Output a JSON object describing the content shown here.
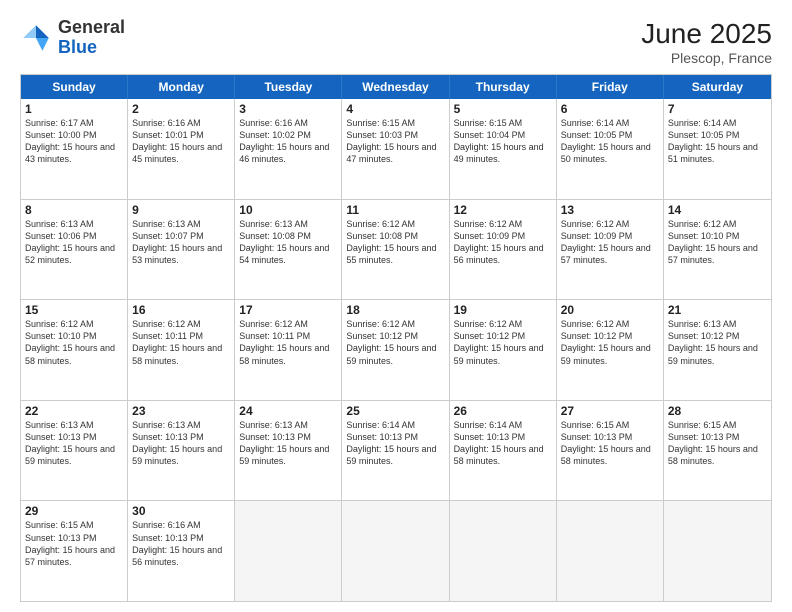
{
  "logo": {
    "general": "General",
    "blue": "Blue"
  },
  "title": {
    "month_year": "June 2025",
    "location": "Plescop, France"
  },
  "weekdays": [
    "Sunday",
    "Monday",
    "Tuesday",
    "Wednesday",
    "Thursday",
    "Friday",
    "Saturday"
  ],
  "rows": [
    [
      {
        "day": "",
        "empty": true
      },
      {
        "day": "2",
        "sr": "Sunrise: 6:16 AM",
        "ss": "Sunset: 10:01 PM",
        "dl": "Daylight: 15 hours and 45 minutes."
      },
      {
        "day": "3",
        "sr": "Sunrise: 6:16 AM",
        "ss": "Sunset: 10:02 PM",
        "dl": "Daylight: 15 hours and 46 minutes."
      },
      {
        "day": "4",
        "sr": "Sunrise: 6:15 AM",
        "ss": "Sunset: 10:03 PM",
        "dl": "Daylight: 15 hours and 47 minutes."
      },
      {
        "day": "5",
        "sr": "Sunrise: 6:15 AM",
        "ss": "Sunset: 10:04 PM",
        "dl": "Daylight: 15 hours and 49 minutes."
      },
      {
        "day": "6",
        "sr": "Sunrise: 6:14 AM",
        "ss": "Sunset: 10:05 PM",
        "dl": "Daylight: 15 hours and 50 minutes."
      },
      {
        "day": "7",
        "sr": "Sunrise: 6:14 AM",
        "ss": "Sunset: 10:05 PM",
        "dl": "Daylight: 15 hours and 51 minutes."
      }
    ],
    [
      {
        "day": "1",
        "sr": "Sunrise: 6:17 AM",
        "ss": "Sunset: 10:00 PM",
        "dl": "Daylight: 15 hours and 43 minutes."
      },
      {
        "day": "",
        "empty": true
      },
      {
        "day": "",
        "empty": true
      },
      {
        "day": "",
        "empty": true
      },
      {
        "day": "",
        "empty": true
      },
      {
        "day": "",
        "empty": true
      },
      {
        "day": "",
        "empty": true
      }
    ],
    [
      {
        "day": "8",
        "sr": "Sunrise: 6:13 AM",
        "ss": "Sunset: 10:06 PM",
        "dl": "Daylight: 15 hours and 52 minutes."
      },
      {
        "day": "9",
        "sr": "Sunrise: 6:13 AM",
        "ss": "Sunset: 10:07 PM",
        "dl": "Daylight: 15 hours and 53 minutes."
      },
      {
        "day": "10",
        "sr": "Sunrise: 6:13 AM",
        "ss": "Sunset: 10:08 PM",
        "dl": "Daylight: 15 hours and 54 minutes."
      },
      {
        "day": "11",
        "sr": "Sunrise: 6:12 AM",
        "ss": "Sunset: 10:08 PM",
        "dl": "Daylight: 15 hours and 55 minutes."
      },
      {
        "day": "12",
        "sr": "Sunrise: 6:12 AM",
        "ss": "Sunset: 10:09 PM",
        "dl": "Daylight: 15 hours and 56 minutes."
      },
      {
        "day": "13",
        "sr": "Sunrise: 6:12 AM",
        "ss": "Sunset: 10:09 PM",
        "dl": "Daylight: 15 hours and 57 minutes."
      },
      {
        "day": "14",
        "sr": "Sunrise: 6:12 AM",
        "ss": "Sunset: 10:10 PM",
        "dl": "Daylight: 15 hours and 57 minutes."
      }
    ],
    [
      {
        "day": "15",
        "sr": "Sunrise: 6:12 AM",
        "ss": "Sunset: 10:10 PM",
        "dl": "Daylight: 15 hours and 58 minutes."
      },
      {
        "day": "16",
        "sr": "Sunrise: 6:12 AM",
        "ss": "Sunset: 10:11 PM",
        "dl": "Daylight: 15 hours and 58 minutes."
      },
      {
        "day": "17",
        "sr": "Sunrise: 6:12 AM",
        "ss": "Sunset: 10:11 PM",
        "dl": "Daylight: 15 hours and 58 minutes."
      },
      {
        "day": "18",
        "sr": "Sunrise: 6:12 AM",
        "ss": "Sunset: 10:12 PM",
        "dl": "Daylight: 15 hours and 59 minutes."
      },
      {
        "day": "19",
        "sr": "Sunrise: 6:12 AM",
        "ss": "Sunset: 10:12 PM",
        "dl": "Daylight: 15 hours and 59 minutes."
      },
      {
        "day": "20",
        "sr": "Sunrise: 6:12 AM",
        "ss": "Sunset: 10:12 PM",
        "dl": "Daylight: 15 hours and 59 minutes."
      },
      {
        "day": "21",
        "sr": "Sunrise: 6:13 AM",
        "ss": "Sunset: 10:12 PM",
        "dl": "Daylight: 15 hours and 59 minutes."
      }
    ],
    [
      {
        "day": "22",
        "sr": "Sunrise: 6:13 AM",
        "ss": "Sunset: 10:13 PM",
        "dl": "Daylight: 15 hours and 59 minutes."
      },
      {
        "day": "23",
        "sr": "Sunrise: 6:13 AM",
        "ss": "Sunset: 10:13 PM",
        "dl": "Daylight: 15 hours and 59 minutes."
      },
      {
        "day": "24",
        "sr": "Sunrise: 6:13 AM",
        "ss": "Sunset: 10:13 PM",
        "dl": "Daylight: 15 hours and 59 minutes."
      },
      {
        "day": "25",
        "sr": "Sunrise: 6:14 AM",
        "ss": "Sunset: 10:13 PM",
        "dl": "Daylight: 15 hours and 59 minutes."
      },
      {
        "day": "26",
        "sr": "Sunrise: 6:14 AM",
        "ss": "Sunset: 10:13 PM",
        "dl": "Daylight: 15 hours and 58 minutes."
      },
      {
        "day": "27",
        "sr": "Sunrise: 6:15 AM",
        "ss": "Sunset: 10:13 PM",
        "dl": "Daylight: 15 hours and 58 minutes."
      },
      {
        "day": "28",
        "sr": "Sunrise: 6:15 AM",
        "ss": "Sunset: 10:13 PM",
        "dl": "Daylight: 15 hours and 58 minutes."
      }
    ],
    [
      {
        "day": "29",
        "sr": "Sunrise: 6:15 AM",
        "ss": "Sunset: 10:13 PM",
        "dl": "Daylight: 15 hours and 57 minutes."
      },
      {
        "day": "30",
        "sr": "Sunrise: 6:16 AM",
        "ss": "Sunset: 10:13 PM",
        "dl": "Daylight: 15 hours and 56 minutes."
      },
      {
        "day": "",
        "empty": true
      },
      {
        "day": "",
        "empty": true
      },
      {
        "day": "",
        "empty": true
      },
      {
        "day": "",
        "empty": true
      },
      {
        "day": "",
        "empty": true
      }
    ]
  ]
}
